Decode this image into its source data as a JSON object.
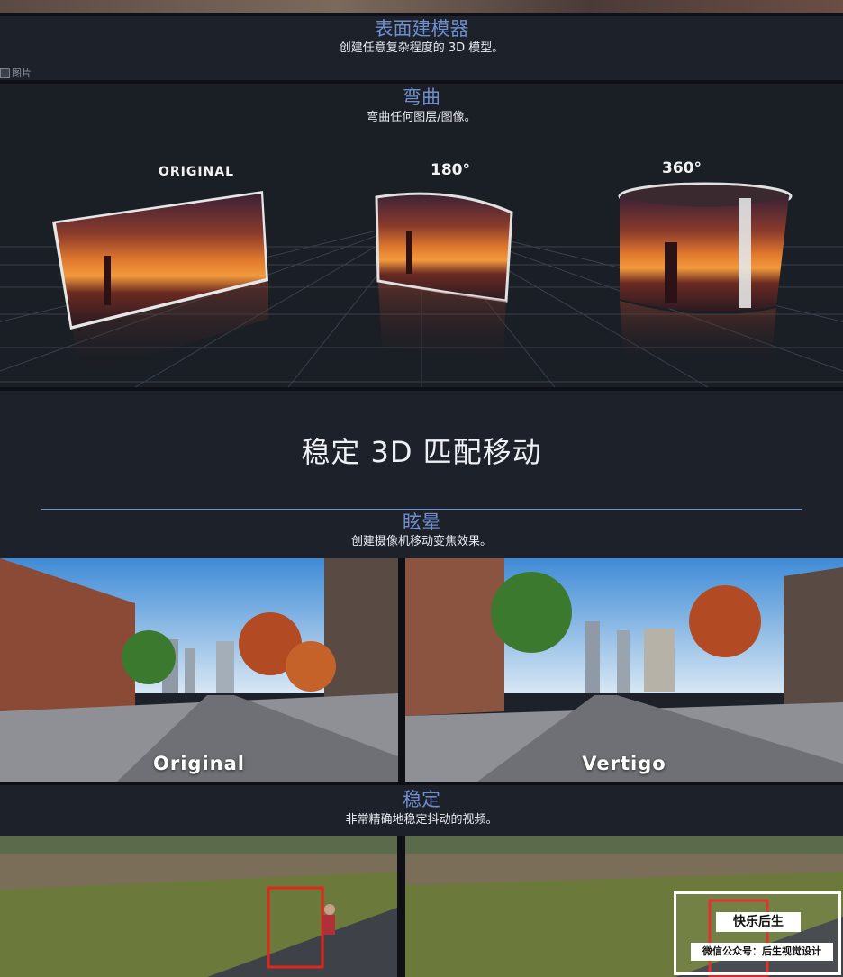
{
  "broken_image_alt": "图片",
  "surface_modeler": {
    "title": "表面建模器",
    "subtitle": "创建任意复杂程度的 3D 模型。"
  },
  "warp": {
    "title": "弯曲",
    "subtitle": "弯曲任何图层/图像。",
    "labels": {
      "original": "ORIGINAL",
      "deg180": "180°",
      "deg360": "360°"
    }
  },
  "stabilize_3d": {
    "title": "稳定 3D 匹配移动"
  },
  "vertigo": {
    "title": "眩晕",
    "subtitle": "创建摄像机移动变焦效果。",
    "left_label": "Original",
    "right_label": "Vertigo"
  },
  "stabilize": {
    "title": "稳定",
    "subtitle": "非常精确地稳定抖动的视频。"
  },
  "badge": {
    "title": "快乐后生",
    "subtitle": "微信公众号：后生视觉设计"
  },
  "colors": {
    "accent": "#6f8fd0",
    "background": "#1d2129",
    "tracker_box": "#e0261e"
  }
}
